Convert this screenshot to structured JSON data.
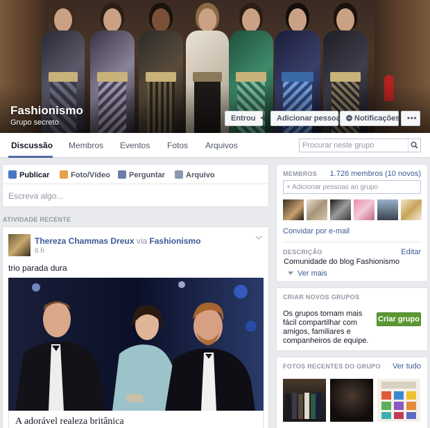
{
  "group": {
    "name": "Fashionismo",
    "privacy": "Grupo secreto",
    "buttons": {
      "joined": "Entrou",
      "add_people": "Adicionar pessoas",
      "notifications": "Notificações",
      "more": "•••"
    }
  },
  "tabs": [
    "Discussão",
    "Membros",
    "Eventos",
    "Fotos",
    "Arquivos"
  ],
  "search": {
    "placeholder": "Procurar neste grupo"
  },
  "composer": {
    "actions": [
      "Publicar",
      "Foto/Vídeo",
      "Perguntar",
      "Arquivo"
    ],
    "placeholder": "Escreva algo..."
  },
  "feed": {
    "section_title": "ATIVIDADE RECENTE",
    "post": {
      "author": "Thereza Chammas Dreux",
      "via": "via",
      "group": "Fashionismo",
      "time": "6 h",
      "text": "trio parada dura",
      "link_title": "A adorável realeza britânica"
    }
  },
  "sidebar": {
    "members": {
      "title": "MEMBROS",
      "count": "1.726 membros (10 novos)",
      "add_placeholder": "+ Adicionar pessoas ao grupo",
      "invite": "Convidar por e-mail"
    },
    "description": {
      "title": "DESCRIÇÃO",
      "edit": "Editar",
      "text": "Comunidade do blog Fashionismo",
      "see_more": "Ver mais"
    },
    "create": {
      "title": "CRIAR NOVOS GRUPOS",
      "text": "Os grupos tornam mais fácil compartilhar com amigos, familiares e companheiros de equipe.",
      "button": "Criar grupo"
    },
    "photos": {
      "title": "FOTOS RECENTES DO GRUPO",
      "see_all": "Ver tudo"
    }
  },
  "colors": {
    "link": "#3b5998",
    "accent_green": "#5b9834",
    "tab_underline": "#4e69a2"
  }
}
